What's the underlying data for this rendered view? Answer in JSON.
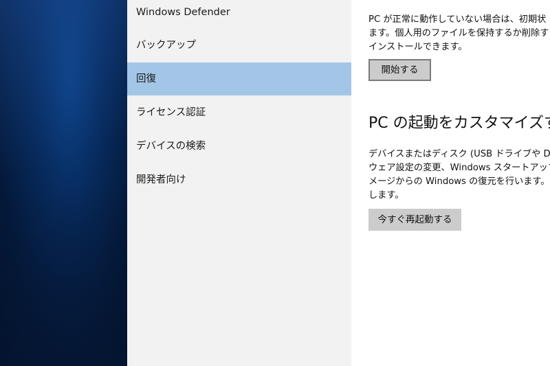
{
  "sidebar": {
    "items": [
      {
        "label": "Windows Defender",
        "selected": false
      },
      {
        "label": "バックアップ",
        "selected": false
      },
      {
        "label": "回復",
        "selected": true
      },
      {
        "label": "ライセンス認証",
        "selected": false
      },
      {
        "label": "デバイスの検索",
        "selected": false
      },
      {
        "label": "開発者向け",
        "selected": false
      }
    ]
  },
  "reset_section": {
    "description_lines": [
      "PC が正常に動作していない場合は、初期状",
      "ます。個人用のファイルを保持するか削除する",
      "インストールできます。"
    ],
    "start_button": "開始する"
  },
  "advanced_startup": {
    "title": "PC の起動をカスタマイズする",
    "description_lines": [
      "デバイスまたはディスク (USB ドライブや DVD な",
      "ウェア設定の変更、Windows スタートアップ設",
      "メージからの Windows の復元を行います。こ",
      "します。"
    ],
    "restart_button": "今すぐ再起動する"
  },
  "colors": {
    "sidebar_bg": "#f2f2f2",
    "selected_bg": "#a3c6e6",
    "button_bg": "#cccccc",
    "content_bg": "#ffffff"
  }
}
